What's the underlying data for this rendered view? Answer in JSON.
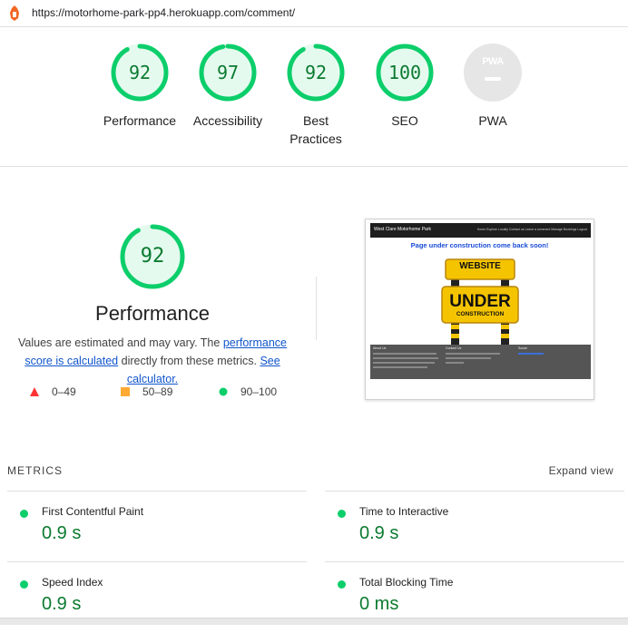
{
  "browser": {
    "url": "https://motorhome-park-pp4.herokuapp.com/comment/"
  },
  "gauges": [
    {
      "score": "92",
      "label": "Performance",
      "fraction": 0.92
    },
    {
      "score": "97",
      "label": "Accessibility",
      "fraction": 0.97
    },
    {
      "score": "92",
      "label": "Best Practices",
      "fraction": 0.92
    },
    {
      "score": "100",
      "label": "SEO",
      "fraction": 1.0
    },
    {
      "score": "",
      "label": "PWA",
      "badge": "PWA"
    }
  ],
  "performance": {
    "score": "92",
    "fraction": 0.92,
    "title": "Performance",
    "desc_prefix": "Values are estimated and may vary. The ",
    "link1": "performance score is calculated",
    "desc_middle": " directly from these metrics. ",
    "link2": "See calculator."
  },
  "legend": [
    {
      "range": "0–49",
      "symbol": "triangle",
      "color": "#ff3333"
    },
    {
      "range": "50–89",
      "symbol": "square",
      "color": "#ffaa33"
    },
    {
      "range": "90–100",
      "symbol": "circle",
      "color": "#0cce6b"
    }
  ],
  "screenshot": {
    "brand": "West Clare Motorhome Park",
    "nav_links": "Home  Explore Locally  Contact us  Leave a comment  Manage Bookings  Logout",
    "heading": "Page under construction come back soon!",
    "sign_top": "WEBSITE",
    "sign_main": "UNDER",
    "sign_sub": "CONSTRUCTION",
    "footer": {
      "about_title": "About Us",
      "contact_title": "Contact Us",
      "social_title": "Social"
    }
  },
  "metrics": {
    "heading": "METRICS",
    "expand_label": "Expand view",
    "items": [
      {
        "name": "First Contentful Paint",
        "value": "0.9 s"
      },
      {
        "name": "Time to Interactive",
        "value": "0.9 s"
      },
      {
        "name": "Speed Index",
        "value": "0.9 s"
      },
      {
        "name": "Total Blocking Time",
        "value": "0 ms"
      }
    ]
  },
  "colors": {
    "pass": "#0cce6b",
    "pass_text": "#0a7a2f",
    "pass_bg": "#e5faef",
    "link": "#1155cc"
  }
}
